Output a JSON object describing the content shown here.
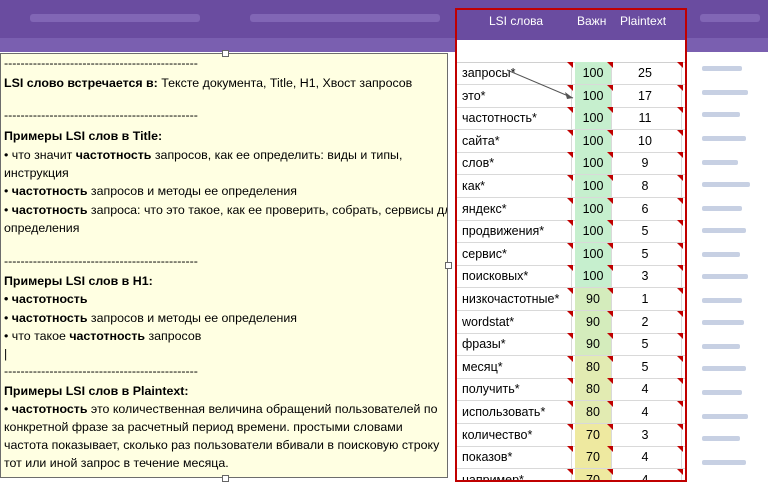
{
  "colors": {
    "header_bg": "#6a4ca0",
    "table_border": "#c00000",
    "comment_bg": "#ffffe2",
    "value_green": "#c6efce",
    "value_yellow": "#ffeb9c"
  },
  "table": {
    "headers": [
      "LSI слова",
      "Важн",
      "Plaintext"
    ],
    "rows": [
      {
        "word": "запросы*",
        "val": "100",
        "plain": "25"
      },
      {
        "word": "это*",
        "val": "100",
        "plain": "17"
      },
      {
        "word": "частотность*",
        "val": "100",
        "plain": "11"
      },
      {
        "word": "сайта*",
        "val": "100",
        "plain": "10"
      },
      {
        "word": "слов*",
        "val": "100",
        "plain": "9"
      },
      {
        "word": "как*",
        "val": "100",
        "plain": "8"
      },
      {
        "word": "яндекс*",
        "val": "100",
        "plain": "6"
      },
      {
        "word": "продвижения*",
        "val": "100",
        "plain": "5"
      },
      {
        "word": "сервис*",
        "val": "100",
        "plain": "5"
      },
      {
        "word": "поисковых*",
        "val": "100",
        "plain": "3"
      },
      {
        "word": "низкочастотные*",
        "val": "90",
        "plain": "1"
      },
      {
        "word": "wordstat*",
        "val": "90",
        "plain": "2"
      },
      {
        "word": "фразы*",
        "val": "90",
        "plain": "5"
      },
      {
        "word": "месяц*",
        "val": "80",
        "plain": "5"
      },
      {
        "word": "получить*",
        "val": "80",
        "plain": "4"
      },
      {
        "word": "использовать*",
        "val": "80",
        "plain": "4"
      },
      {
        "word": "количество*",
        "val": "70",
        "plain": "3"
      },
      {
        "word": "показов*",
        "val": "70",
        "plain": "4"
      },
      {
        "word": "например*",
        "val": "70",
        "plain": "4"
      }
    ]
  },
  "comment": {
    "sep": "-----------------------------------------------",
    "l1_bold": "LSI слово встречается в:",
    "l1_rest": " Тексте документа, Title, H1, Хвост запросов",
    "title_head": "Примеры LSI слов в Title:",
    "t1a": "• что значит ",
    "t1b": "частотность",
    "t1c": " запросов, как ее определить: виды и типы,",
    "t1d": "инструкция",
    "t2a": "• ",
    "t2b": "частотность",
    "t2c": " запросов и методы ее определения",
    "t3a": "• ",
    "t3b": "частотность",
    "t3c": " запроса: что это такое, как ее проверить, собрать, сервисы для",
    "t3d": "определения",
    "h1_head": "Примеры LSI слов в H1:",
    "h1a": "• частотность",
    "h2a": "• ",
    "h2b": "частотность",
    "h2c": " запросов и методы ее определения",
    "h3a": "• что такое ",
    "h3b": "частотность",
    "h3c": " запросов",
    "cursor": "|",
    "plain_head": "Примеры LSI слов в Plaintext:",
    "p1a": "• ",
    "p1b": "частотность",
    "p1c": "  это количественная величина обращений пользователей по",
    "p2": "конкретной фразе за расчетный период времени. простыми словами",
    "p3": "частота показывает, сколько раз пользователи вбивали в поисковую строку",
    "p4": "тот или иной запрос в течение месяца."
  }
}
